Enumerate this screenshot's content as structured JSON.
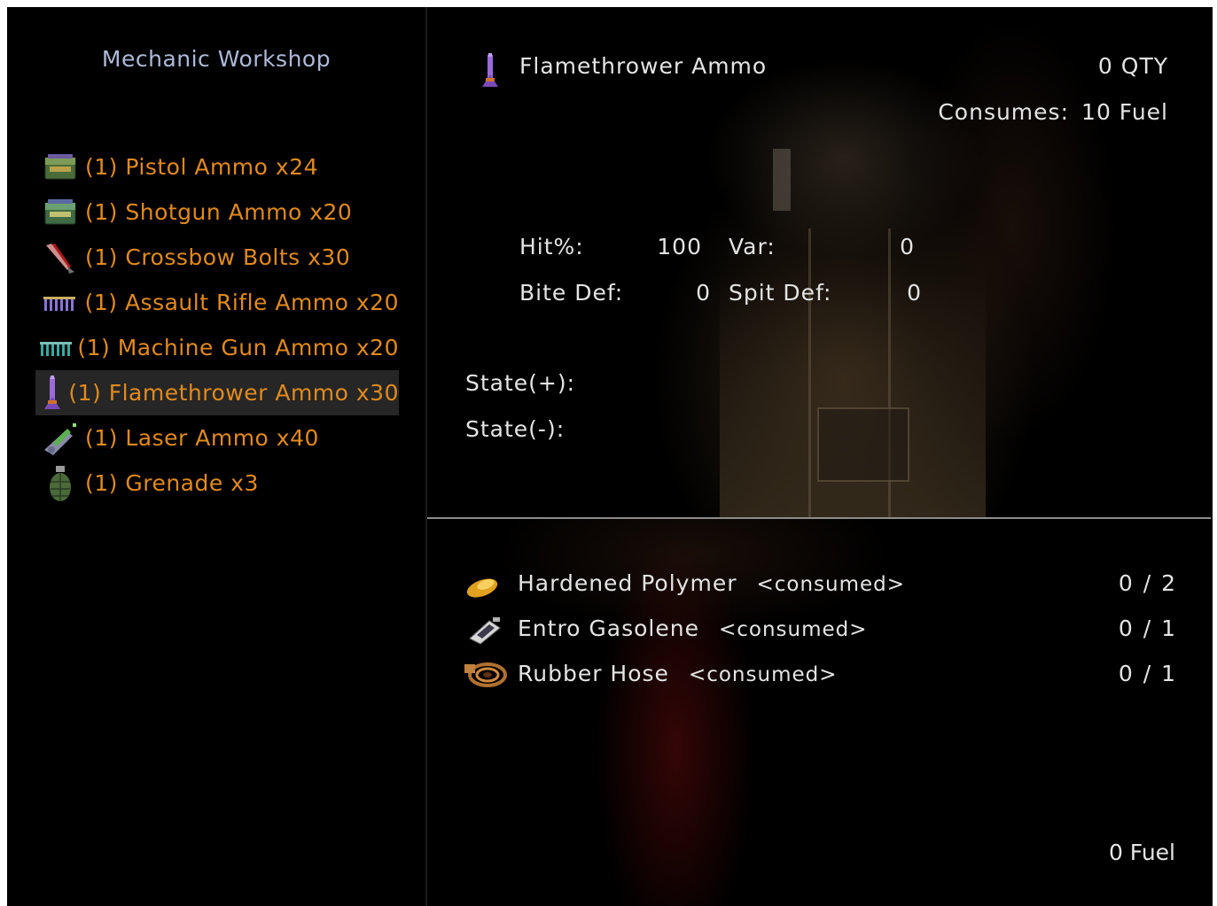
{
  "workshop": {
    "title": "Mechanic Workshop",
    "recipes": [
      {
        "label": "(1) Pistol Ammo x24",
        "icon": "ammo-box-icon"
      },
      {
        "label": "(1) Shotgun Ammo x20",
        "icon": "ammo-box-icon"
      },
      {
        "label": "(1) Crossbow Bolts x30",
        "icon": "bolt-icon"
      },
      {
        "label": "(1) Assault Rifle Ammo x20",
        "icon": "bullets-icon"
      },
      {
        "label": "(1) Machine Gun Ammo x20",
        "icon": "bullets-icon"
      },
      {
        "label": "(1) Flamethrower Ammo x30",
        "icon": "flame-canister-icon",
        "selected": true
      },
      {
        "label": "(1) Laser Ammo x40",
        "icon": "laser-gun-icon"
      },
      {
        "label": "(1) Grenade x3",
        "icon": "grenade-icon"
      }
    ]
  },
  "detail": {
    "item_name": "Flamethrower Ammo",
    "item_icon": "flame-canister-icon",
    "qty": "0 QTY",
    "consumes_label": "Consumes:",
    "consumes_value": "10 Fuel",
    "stats": {
      "hit_label": "Hit%:",
      "hit_value": "100",
      "var_label": "Var:",
      "var_value": "0",
      "bite_label": "Bite Def:",
      "bite_value": "0",
      "spit_label": "Spit Def:",
      "spit_value": "0"
    },
    "state_plus": "State(+):",
    "state_minus": "State(-):"
  },
  "materials": [
    {
      "name": "Hardened Polymer",
      "tag": "<consumed>",
      "count": "0 / 2",
      "icon": "polymer-icon"
    },
    {
      "name": "Entro Gasolene",
      "tag": "<consumed>",
      "count": "0 / 1",
      "icon": "gasoline-can-icon"
    },
    {
      "name": "Rubber Hose",
      "tag": "<consumed>",
      "count": "0 / 1",
      "icon": "hose-icon"
    }
  ],
  "fuel_total": "0 Fuel",
  "colors": {
    "title": "#aeb9d8",
    "recipe_text": "#e08a1e",
    "detail_text": "#e4e4e4",
    "selected_row": "#262626"
  }
}
